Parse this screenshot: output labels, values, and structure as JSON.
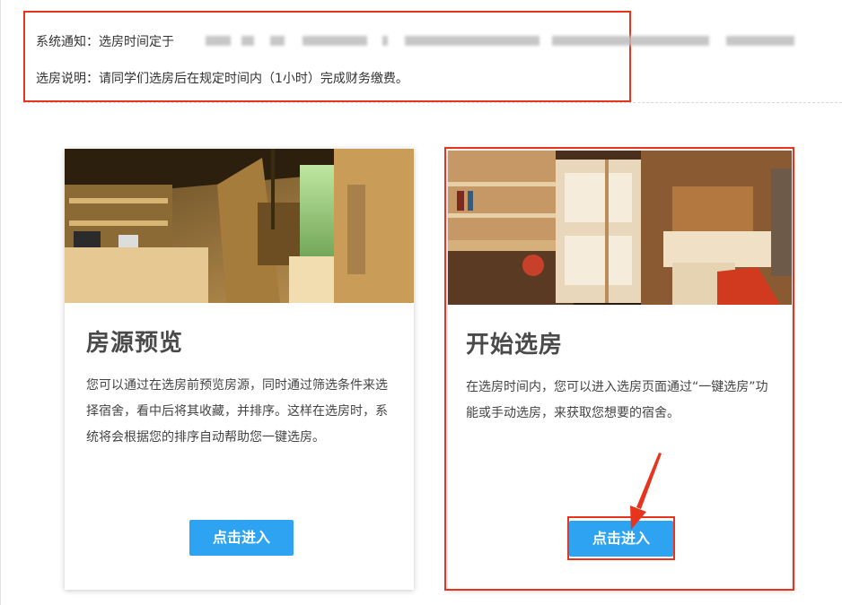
{
  "notice": {
    "line1": "系统通知：选房时间定于",
    "line2": "选房说明：请同学们选房后在规定时间内（1小时）完成财务缴费。"
  },
  "cards": [
    {
      "title": "房源预览",
      "description": "您可以通过在选房前预览房源，同时通过筛选条件来选择宿舍，看中后将其收藏，并排序。这样在选房时，系统将会根据您的排序自动帮助您一键选房。",
      "button_label": "点击进入"
    },
    {
      "title": "开始选房",
      "description": "在选房时间内，您可以进入选房页面通过“一键选房”功能或手动选房，来获取您想要的宿舍。",
      "button_label": "点击进入"
    }
  ],
  "colors": {
    "highlight": "#e8341c",
    "button": "#2ea3f2"
  }
}
